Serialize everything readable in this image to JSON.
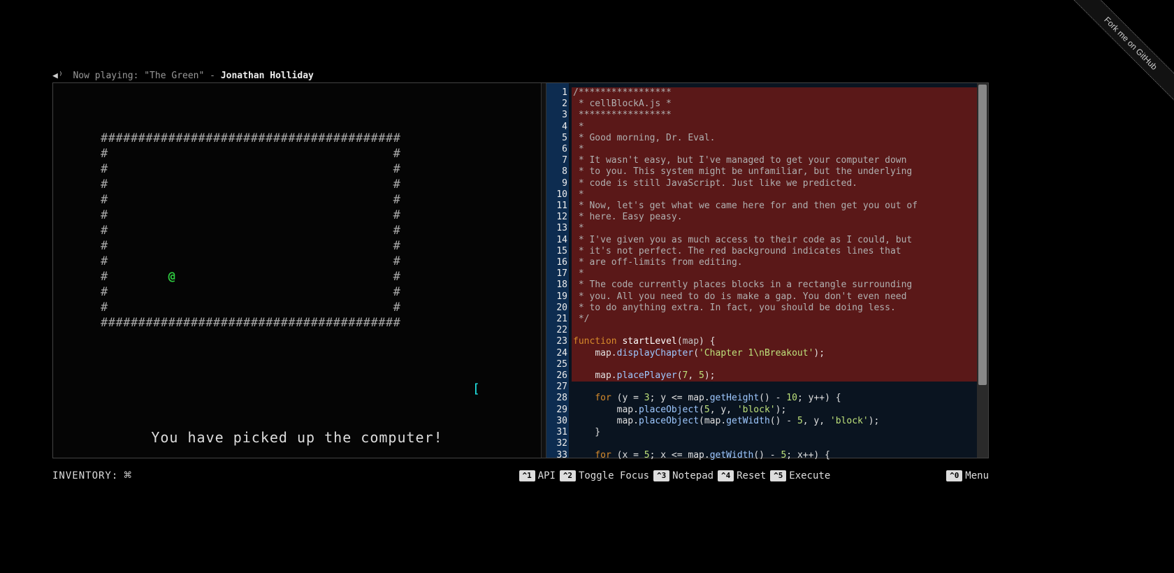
{
  "fork_ribbon": "Fork me on GitHub",
  "now_playing": {
    "prefix": "Now playing: ",
    "track": "\"The Green\"",
    "sep": " - ",
    "artist": "Jonathan Holliday"
  },
  "game": {
    "player_glyph": "@",
    "computer_glyph": "[",
    "message": "You have picked up the computer!"
  },
  "inventory": {
    "label": "INVENTORY:"
  },
  "shortcuts": {
    "api": {
      "key": "^1",
      "label": "API"
    },
    "focus": {
      "key": "^2",
      "label": "Toggle Focus"
    },
    "notepad": {
      "key": "^3",
      "label": "Notepad"
    },
    "reset": {
      "key": "^4",
      "label": "Reset"
    },
    "execute": {
      "key": "^5",
      "label": "Execute"
    },
    "menu": {
      "key": "^0",
      "label": "Menu"
    }
  },
  "gutter_lines": 33,
  "readonly_ranges": [
    [
      1,
      26
    ]
  ],
  "code_lines": [
    {
      "n": 1,
      "cls": "c-comment",
      "text": "/*****************"
    },
    {
      "n": 2,
      "cls": "c-comment",
      "text": " * cellBlockA.js *"
    },
    {
      "n": 3,
      "cls": "c-comment",
      "text": " *****************"
    },
    {
      "n": 4,
      "cls": "c-comment",
      "text": " *"
    },
    {
      "n": 5,
      "cls": "c-comment",
      "text": " * Good morning, Dr. Eval."
    },
    {
      "n": 6,
      "cls": "c-comment",
      "text": " *"
    },
    {
      "n": 7,
      "cls": "c-comment",
      "text": " * It wasn't easy, but I've managed to get your computer down"
    },
    {
      "n": 8,
      "cls": "c-comment",
      "text": " * to you. This system might be unfamiliar, but the underlying"
    },
    {
      "n": 9,
      "cls": "c-comment",
      "text": " * code is still JavaScript. Just like we predicted."
    },
    {
      "n": 10,
      "cls": "c-comment",
      "text": " *"
    },
    {
      "n": 11,
      "cls": "c-comment",
      "text": " * Now, let's get what we came here for and then get you out of"
    },
    {
      "n": 12,
      "cls": "c-comment",
      "text": " * here. Easy peasy."
    },
    {
      "n": 13,
      "cls": "c-comment",
      "text": " *"
    },
    {
      "n": 14,
      "cls": "c-comment",
      "text": " * I've given you as much access to their code as I could, but"
    },
    {
      "n": 15,
      "cls": "c-comment",
      "text": " * it's not perfect. The red background indicates lines that"
    },
    {
      "n": 16,
      "cls": "c-comment",
      "text": " * are off-limits from editing."
    },
    {
      "n": 17,
      "cls": "c-comment",
      "text": " *"
    },
    {
      "n": 18,
      "cls": "c-comment",
      "text": " * The code currently places blocks in a rectangle surrounding"
    },
    {
      "n": 19,
      "cls": "c-comment",
      "text": " * you. All you need to do is make a gap. You don't even need"
    },
    {
      "n": 20,
      "cls": "c-comment",
      "text": " * to do anything extra. In fact, you should be doing less."
    },
    {
      "n": 21,
      "cls": "c-comment",
      "text": " */"
    },
    {
      "n": 22,
      "raw": ""
    },
    {
      "n": 23,
      "tokens": [
        [
          "c-keyword",
          "function "
        ],
        [
          "c-func",
          "startLevel"
        ],
        [
          "c-punct",
          "("
        ],
        [
          "c-param",
          "map"
        ],
        [
          "c-punct",
          ") {"
        ]
      ]
    },
    {
      "n": 24,
      "tokens": [
        [
          "",
          "    "
        ],
        [
          "c-ident",
          "map"
        ],
        [
          "c-punct",
          "."
        ],
        [
          "c-method",
          "displayChapter"
        ],
        [
          "c-punct",
          "("
        ],
        [
          "c-str",
          "'Chapter 1\\nBreakout'"
        ],
        [
          "c-punct",
          ");"
        ]
      ]
    },
    {
      "n": 25,
      "raw": ""
    },
    {
      "n": 26,
      "tokens": [
        [
          "",
          "    "
        ],
        [
          "c-ident",
          "map"
        ],
        [
          "c-punct",
          "."
        ],
        [
          "c-method",
          "placePlayer"
        ],
        [
          "c-punct",
          "("
        ],
        [
          "c-num",
          "7"
        ],
        [
          "c-punct",
          ", "
        ],
        [
          "c-num",
          "5"
        ],
        [
          "c-punct",
          ");"
        ]
      ]
    },
    {
      "n": 27,
      "raw": ""
    },
    {
      "n": 28,
      "tokens": [
        [
          "",
          "    "
        ],
        [
          "c-keyword",
          "for"
        ],
        [
          "c-punct",
          " ("
        ],
        [
          "c-ident",
          "y"
        ],
        [
          "c-punct",
          " = "
        ],
        [
          "c-num",
          "3"
        ],
        [
          "c-punct",
          "; "
        ],
        [
          "c-ident",
          "y"
        ],
        [
          "c-punct",
          " <= "
        ],
        [
          "c-ident",
          "map"
        ],
        [
          "c-punct",
          "."
        ],
        [
          "c-method",
          "getHeight"
        ],
        [
          "c-punct",
          "() - "
        ],
        [
          "c-num",
          "10"
        ],
        [
          "c-punct",
          "; "
        ],
        [
          "c-ident",
          "y"
        ],
        [
          "c-punct",
          "++) {"
        ]
      ]
    },
    {
      "n": 29,
      "tokens": [
        [
          "",
          "        "
        ],
        [
          "c-ident",
          "map"
        ],
        [
          "c-punct",
          "."
        ],
        [
          "c-method",
          "placeObject"
        ],
        [
          "c-punct",
          "("
        ],
        [
          "c-num",
          "5"
        ],
        [
          "c-punct",
          ", "
        ],
        [
          "c-ident",
          "y"
        ],
        [
          "c-punct",
          ", "
        ],
        [
          "c-str",
          "'block'"
        ],
        [
          "c-punct",
          ");"
        ]
      ]
    },
    {
      "n": 30,
      "tokens": [
        [
          "",
          "        "
        ],
        [
          "c-ident",
          "map"
        ],
        [
          "c-punct",
          "."
        ],
        [
          "c-method",
          "placeObject"
        ],
        [
          "c-punct",
          "("
        ],
        [
          "c-ident",
          "map"
        ],
        [
          "c-punct",
          "."
        ],
        [
          "c-method",
          "getWidth"
        ],
        [
          "c-punct",
          "() - "
        ],
        [
          "c-num",
          "5"
        ],
        [
          "c-punct",
          ", "
        ],
        [
          "c-ident",
          "y"
        ],
        [
          "c-punct",
          ", "
        ],
        [
          "c-str",
          "'block'"
        ],
        [
          "c-punct",
          ");"
        ]
      ]
    },
    {
      "n": 31,
      "tokens": [
        [
          "c-punct",
          "    }"
        ]
      ]
    },
    {
      "n": 32,
      "raw": ""
    },
    {
      "n": 33,
      "tokens": [
        [
          "",
          "    "
        ],
        [
          "c-keyword",
          "for"
        ],
        [
          "c-punct",
          " ("
        ],
        [
          "c-ident",
          "x"
        ],
        [
          "c-punct",
          " = "
        ],
        [
          "c-num",
          "5"
        ],
        [
          "c-punct",
          "; "
        ],
        [
          "c-ident",
          "x"
        ],
        [
          "c-punct",
          " <= "
        ],
        [
          "c-ident",
          "map"
        ],
        [
          "c-punct",
          "."
        ],
        [
          "c-method",
          "getWidth"
        ],
        [
          "c-punct",
          "() - "
        ],
        [
          "c-num",
          "5"
        ],
        [
          "c-punct",
          "; "
        ],
        [
          "c-ident",
          "x"
        ],
        [
          "c-punct",
          "++) {"
        ]
      ]
    }
  ]
}
